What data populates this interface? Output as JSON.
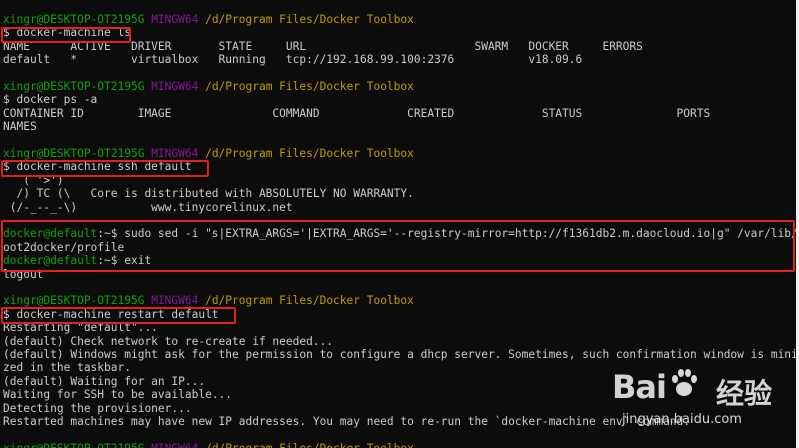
{
  "lines": [
    {
      "segs": [
        {
          "t": "xingr@DESKTOP-OT2195G ",
          "c": "green"
        },
        {
          "t": "MINGW64 ",
          "c": "purple"
        },
        {
          "t": "/d/Program Files/Docker Toolbox",
          "c": "yellow"
        }
      ]
    },
    {
      "segs": [
        {
          "t": "$ docker-machine ls",
          "c": "gray"
        }
      ]
    },
    {
      "segs": [
        {
          "t": "NAME      ACTIVE   DRIVER       STATE     URL                         SWARM   DOCKER     ERRORS",
          "c": "gray"
        }
      ]
    },
    {
      "segs": [
        {
          "t": "default   *        virtualbox   Running   tcp://192.168.99.100:2376           v18.09.6",
          "c": "gray"
        }
      ]
    },
    {
      "segs": [
        {
          "t": "",
          "c": "gray"
        }
      ]
    },
    {
      "segs": [
        {
          "t": "xingr@DESKTOP-OT2195G ",
          "c": "green"
        },
        {
          "t": "MINGW64 ",
          "c": "purple"
        },
        {
          "t": "/d/Program Files/Docker Toolbox",
          "c": "yellow"
        }
      ]
    },
    {
      "segs": [
        {
          "t": "$ docker ps -a",
          "c": "gray"
        }
      ]
    },
    {
      "segs": [
        {
          "t": "CONTAINER ID        IMAGE               COMMAND             CREATED             STATUS              PORTS",
          "c": "gray"
        }
      ]
    },
    {
      "segs": [
        {
          "t": "NAMES",
          "c": "gray"
        }
      ]
    },
    {
      "segs": [
        {
          "t": "",
          "c": "gray"
        }
      ]
    },
    {
      "segs": [
        {
          "t": "xingr@DESKTOP-OT2195G ",
          "c": "green"
        },
        {
          "t": "MINGW64 ",
          "c": "purple"
        },
        {
          "t": "/d/Program Files/Docker Toolbox",
          "c": "yellow"
        }
      ]
    },
    {
      "segs": [
        {
          "t": "$ docker-machine ssh default",
          "c": "gray"
        }
      ]
    },
    {
      "segs": [
        {
          "t": "   ( '>')",
          "c": "gray"
        }
      ]
    },
    {
      "segs": [
        {
          "t": "  /) TC (\\   Core is distributed with ABSOLUTELY NO WARRANTY.",
          "c": "gray"
        }
      ]
    },
    {
      "segs": [
        {
          "t": " (/-_--_-\\)           www.tinycorelinux.net",
          "c": "gray"
        }
      ]
    },
    {
      "segs": [
        {
          "t": "",
          "c": "gray"
        }
      ]
    },
    {
      "segs": [
        {
          "t": "docker@default",
          "c": "green"
        },
        {
          "t": ":~$ sudo sed -i \"s|EXTRA_ARGS='|EXTRA_ARGS='--registry-mirror=http://f1361db2.m.daocloud.io|g\" /var/lib/b",
          "c": "gray"
        }
      ]
    },
    {
      "segs": [
        {
          "t": "oot2docker/profile",
          "c": "gray"
        }
      ]
    },
    {
      "segs": [
        {
          "t": "docker@default",
          "c": "green"
        },
        {
          "t": ":~$ exit",
          "c": "gray"
        }
      ]
    },
    {
      "segs": [
        {
          "t": "logout",
          "c": "gray"
        }
      ]
    },
    {
      "segs": [
        {
          "t": "",
          "c": "gray"
        }
      ]
    },
    {
      "segs": [
        {
          "t": "xingr@DESKTOP-OT2195G ",
          "c": "green"
        },
        {
          "t": "MINGW64 ",
          "c": "purple"
        },
        {
          "t": "/d/Program Files/Docker Toolbox",
          "c": "yellow"
        }
      ]
    },
    {
      "segs": [
        {
          "t": "$ docker-machine restart default",
          "c": "gray"
        }
      ]
    },
    {
      "segs": [
        {
          "t": "Restarting \"default\"...",
          "c": "gray"
        }
      ]
    },
    {
      "segs": [
        {
          "t": "(default) Check network to re-create if needed...",
          "c": "gray"
        }
      ]
    },
    {
      "segs": [
        {
          "t": "(default) Windows might ask for the permission to configure a dhcp server. Sometimes, such confirmation window is minimi",
          "c": "gray"
        }
      ]
    },
    {
      "segs": [
        {
          "t": "zed in the taskbar.",
          "c": "gray"
        }
      ]
    },
    {
      "segs": [
        {
          "t": "(default) Waiting for an IP...",
          "c": "gray"
        }
      ]
    },
    {
      "segs": [
        {
          "t": "Waiting for SSH to be available...",
          "c": "gray"
        }
      ]
    },
    {
      "segs": [
        {
          "t": "Detecting the provisioner...",
          "c": "gray"
        }
      ]
    },
    {
      "segs": [
        {
          "t": "Restarted machines may have new IP addresses. You may need to re-run the `docker-machine env` command.",
          "c": "gray"
        }
      ]
    },
    {
      "segs": [
        {
          "t": "",
          "c": "gray"
        }
      ]
    },
    {
      "segs": [
        {
          "t": "xingr@DESKTOP-OT2195G ",
          "c": "green"
        },
        {
          "t": "MINGW64 ",
          "c": "purple"
        },
        {
          "t": "/d/Program Files/Docker Toolbox",
          "c": "yellow"
        }
      ]
    }
  ],
  "colors": {
    "green": "#13a10e",
    "purple": "#881798",
    "yellow": "#c19c00",
    "gray": "#cccccc",
    "highlight": "#e0211d"
  },
  "watermark": {
    "logo": "Bai",
    "cn": "经验",
    "url": "jingyan.baidu.com",
    "icon": "paw-icon"
  }
}
